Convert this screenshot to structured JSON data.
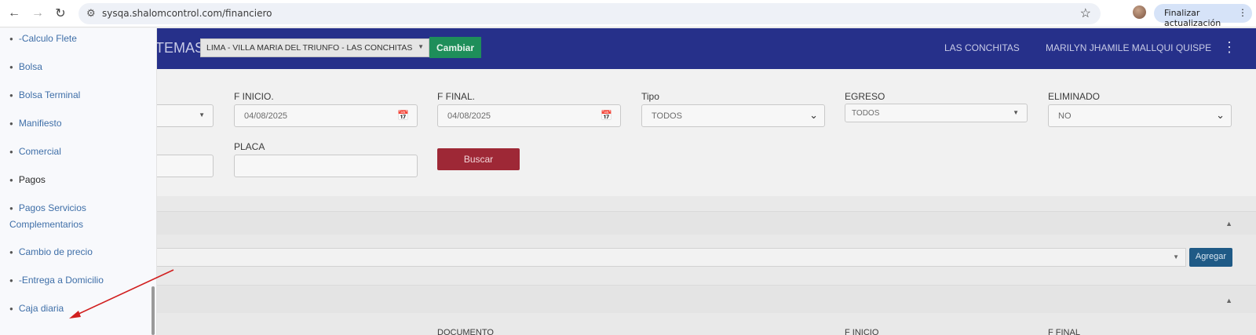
{
  "browser": {
    "url": "sysqa.shalomcontrol.com/financiero",
    "update_label": "Finalizar actualización"
  },
  "header": {
    "title_fragment": "TEMAS",
    "branch_value": "LIMA - VILLA MARIA DEL TRIUNFO - LAS CONCHITAS",
    "change_button": "Cambiar",
    "location": "LAS CONCHITAS",
    "user": "MARILYN JHAMILE MALLQUI QUISPE"
  },
  "filters": {
    "f_inicio_label": "F INICIO.",
    "f_inicio_value": "04/08/2025",
    "f_final_label": "F FINAL.",
    "f_final_value": "04/08/2025",
    "tipo_label": "Tipo",
    "tipo_value": "TODOS",
    "egreso_label": "EGRESO",
    "egreso_value": "TODOS",
    "eliminado_label": "ELIMINADO",
    "eliminado_value": "NO",
    "placa_label": "PLACA",
    "placa_value": "",
    "search_button": "Buscar"
  },
  "section2": {
    "add_button": "Agregar"
  },
  "table": {
    "col_documento": "DOCUMENTO",
    "col_f_inicio": "F INICIO",
    "col_f_final": "F FINAL"
  },
  "sidebar": {
    "items": [
      {
        "label": "-Calculo Flete"
      },
      {
        "label": "Bolsa"
      },
      {
        "label": "Bolsa Terminal"
      },
      {
        "label": "Manifiesto"
      },
      {
        "label": "Comercial"
      },
      {
        "label": "Pagos"
      },
      {
        "label": "Pagos Servicios",
        "label2": "Complementarios"
      },
      {
        "label": "Cambio de precio"
      },
      {
        "label": "-Entrega a Domicilio"
      },
      {
        "label": "Caja diaria"
      }
    ]
  },
  "colors": {
    "header_bg": "#26308a",
    "accent_green": "#1e8e5a",
    "accent_red": "#9e2836",
    "link_blue": "#3f6fa8",
    "arrow_red": "#d11f1f"
  }
}
